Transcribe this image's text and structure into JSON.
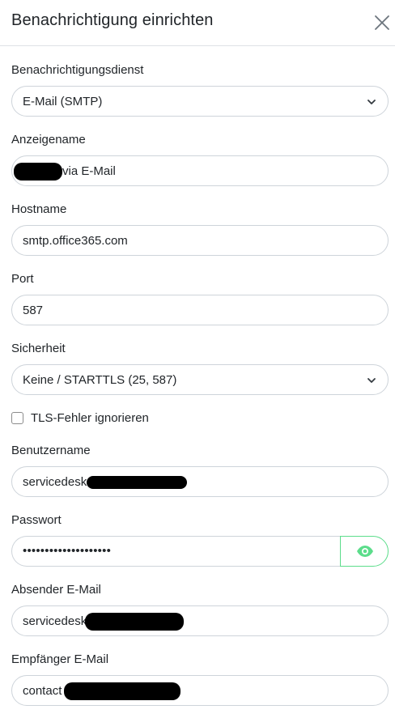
{
  "dialog": {
    "title": "Benachrichtigung einrichten",
    "close_icon": "close-icon"
  },
  "fields": {
    "service": {
      "label": "Benachrichtigungsdienst",
      "value": "E-Mail (SMTP)"
    },
    "display_name": {
      "label": "Anzeigename",
      "value": "via E-Mail"
    },
    "hostname": {
      "label": "Hostname",
      "value": "smtp.office365.com"
    },
    "port": {
      "label": "Port",
      "value": "587"
    },
    "security": {
      "label": "Sicherheit",
      "value": "Keine / STARTTLS (25, 587)"
    },
    "ignore_tls": {
      "label": "TLS-Fehler ignorieren",
      "checked": false
    },
    "username": {
      "label": "Benutzername",
      "value": "servicedesk"
    },
    "password": {
      "label": "Passwort",
      "value": "••••••••••••••••••••",
      "toggle_icon": "eye-icon"
    },
    "sender": {
      "label": "Absender E-Mail",
      "value": "servicedesk"
    },
    "recipient": {
      "label": "Empfänger E-Mail",
      "value": "contact"
    }
  },
  "colors": {
    "accent": "#5cdd8b",
    "border": "#ced4da"
  }
}
